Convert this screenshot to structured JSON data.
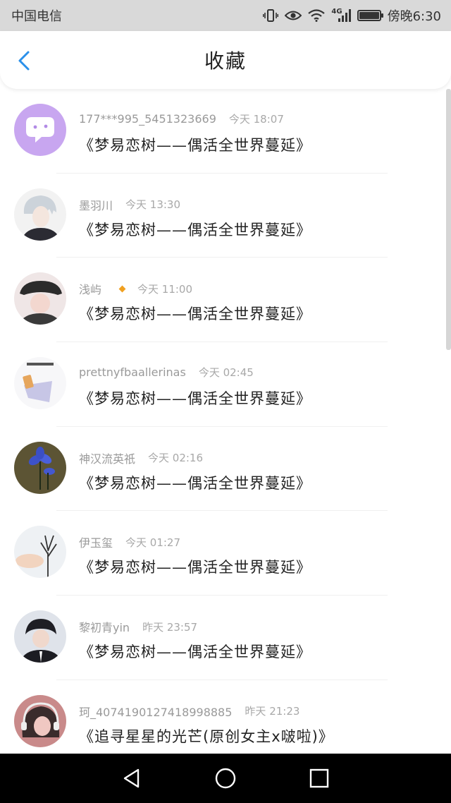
{
  "status_bar": {
    "carrier": "中国电信",
    "network": "4G",
    "time": "傍晚6:30"
  },
  "header": {
    "title": "收藏"
  },
  "items": [
    {
      "user": "177***995_5451323669",
      "time": "今天 18:07",
      "title": "《梦易恋树——偶活全世界蔓延》",
      "avatar": "chat-bubble"
    },
    {
      "user": "墨羽川",
      "time": "今天 13:30",
      "title": "《梦易恋树——偶活全世界蔓延》",
      "avatar": "anime-boy"
    },
    {
      "user": "浅屿",
      "time": "今天 11:00",
      "title": "《梦易恋树——偶活全世界蔓延》",
      "avatar": "boy-cap",
      "badge": true
    },
    {
      "user": "prettnyfbaallerinas",
      "time": "今天 02:45",
      "title": "《梦易恋树——偶活全世界蔓延》",
      "avatar": "poster"
    },
    {
      "user": "神汉流英祇",
      "time": "今天 02:16",
      "title": "《梦易恋树——偶活全世界蔓延》",
      "avatar": "blue-flower"
    },
    {
      "user": "伊玉玺",
      "time": "今天 01:27",
      "title": "《梦易恋树——偶活全世界蔓延》",
      "avatar": "tree-sky"
    },
    {
      "user": "黎初青yin",
      "time": "昨天 23:57",
      "title": "《梦易恋树——偶活全世界蔓延》",
      "avatar": "boy-suit"
    },
    {
      "user": "珂_4074190127418998885",
      "time": "昨天 21:23",
      "title": "《追寻星星的光芒(原创女主x啵啦)》",
      "avatar": "girl-headphones"
    }
  ]
}
